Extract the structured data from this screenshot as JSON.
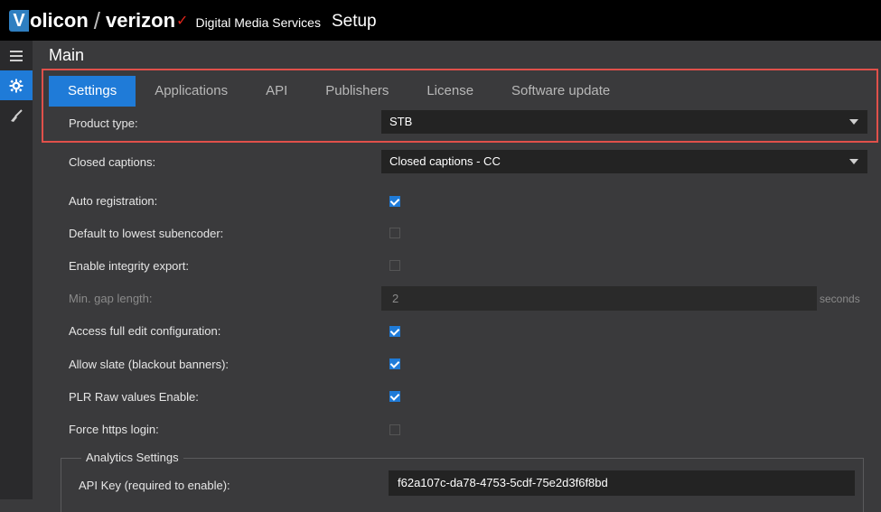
{
  "header": {
    "logo_letter": "V",
    "brand": "olicon",
    "brand2": "verizon",
    "subtitle": "Digital Media Services",
    "page": "Setup"
  },
  "sidebar": {
    "items": [
      {
        "icon": "menu-icon"
      },
      {
        "icon": "gear-icon",
        "active": true
      },
      {
        "icon": "broom-icon"
      }
    ]
  },
  "main": {
    "title": "Main"
  },
  "tabs": [
    "Settings",
    "Applications",
    "API",
    "Publishers",
    "License",
    "Software update"
  ],
  "settings": {
    "product_type": {
      "label": "Product type:",
      "value": "STB"
    },
    "closed_captions": {
      "label": "Closed captions:",
      "value": "Closed captions - CC"
    },
    "auto_registration": {
      "label": "Auto registration:",
      "checked": true
    },
    "default_lowest": {
      "label": "Default to lowest subencoder:",
      "checked": false
    },
    "integrity_export": {
      "label": "Enable integrity export:",
      "checked": false
    },
    "min_gap": {
      "label": "Min. gap length:",
      "value": "2",
      "unit": "seconds"
    },
    "full_edit": {
      "label": "Access full edit configuration:",
      "checked": true
    },
    "allow_slate": {
      "label": "Allow slate (blackout banners):",
      "checked": true
    },
    "plr_raw": {
      "label": "PLR Raw values Enable:",
      "checked": true
    },
    "force_https": {
      "label": "Force https login:",
      "checked": false
    }
  },
  "analytics": {
    "legend": "Analytics Settings",
    "api_key_label": "API Key (required to enable):",
    "api_key_value": "f62a107c-da78-4753-5cdf-75e2d3f6f8bd"
  },
  "colors": {
    "accent": "#1f7bd8",
    "highlight": "#e0504a",
    "background": "#3a3a3c"
  }
}
